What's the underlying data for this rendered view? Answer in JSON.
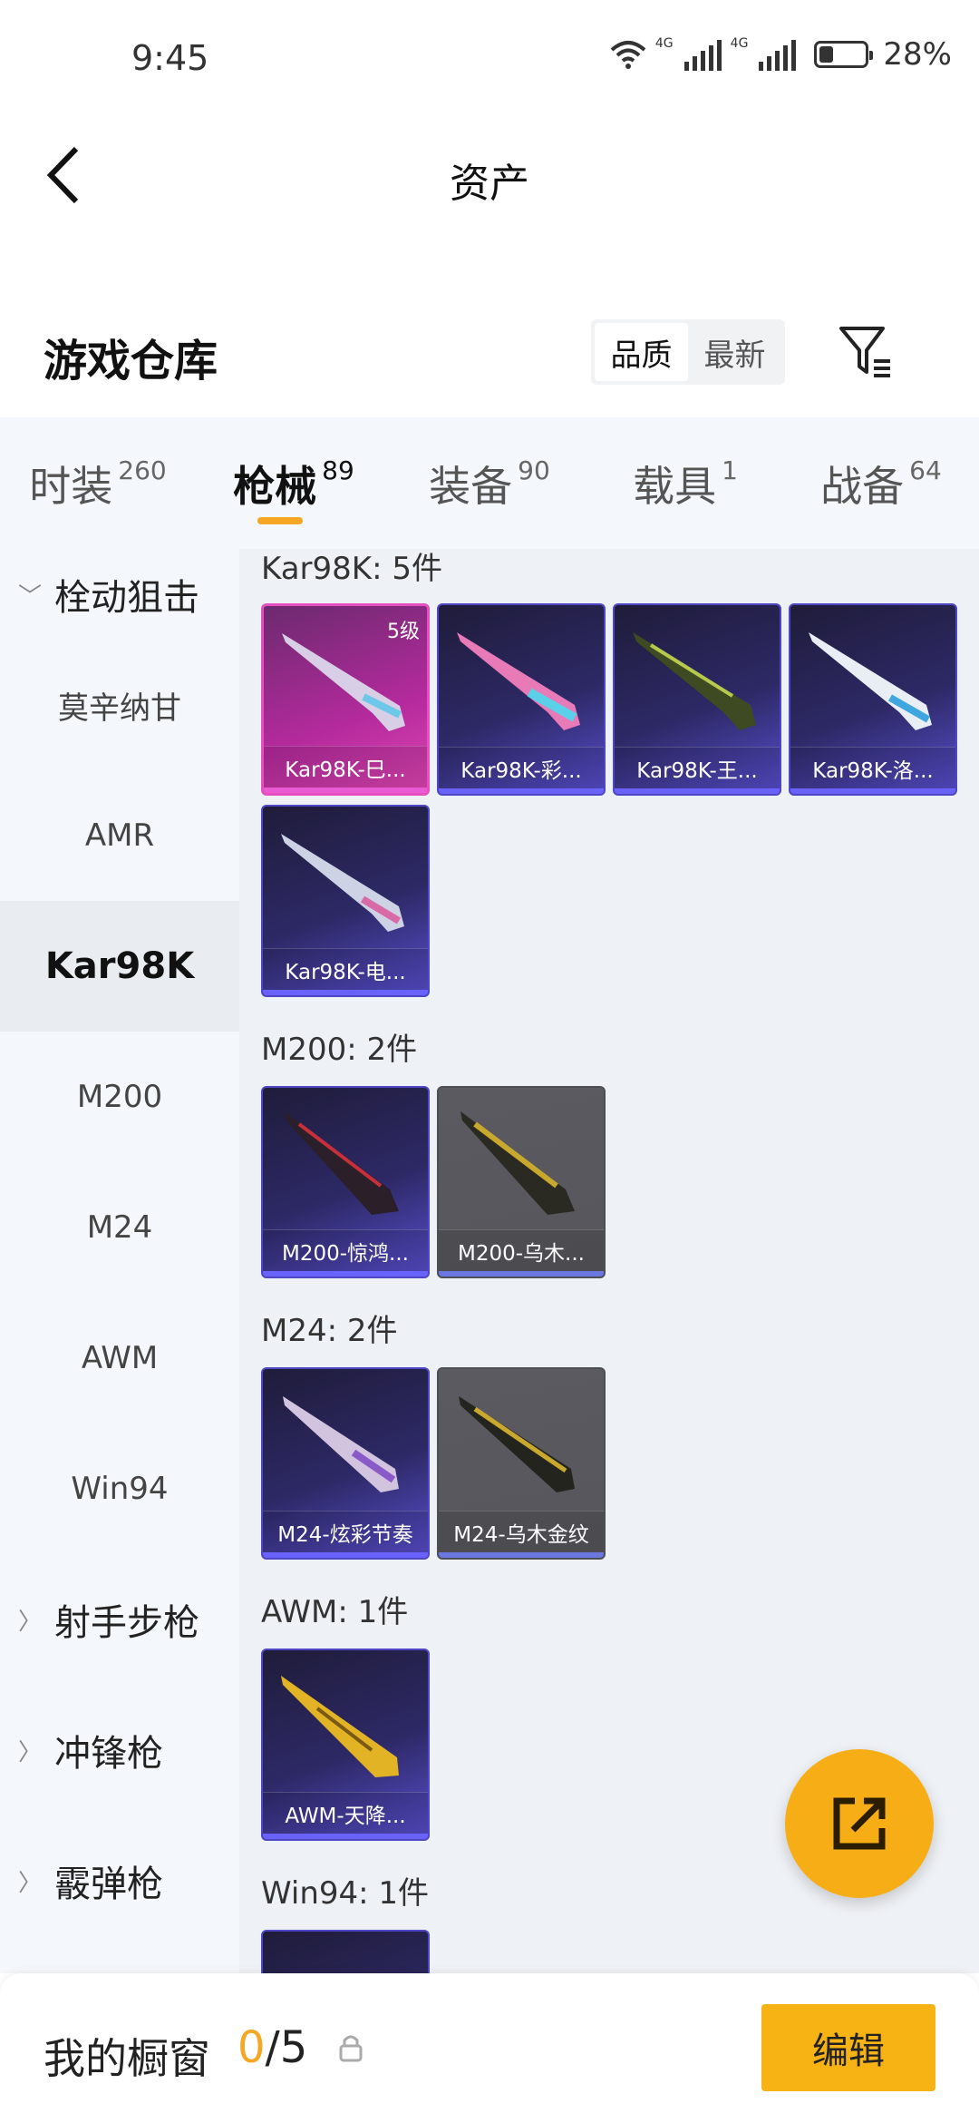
{
  "status": {
    "time": "9:45",
    "net1": "4G",
    "net2": "4G",
    "battery_pct": "28%",
    "battery_level": 0.28
  },
  "nav": {
    "title": "资产"
  },
  "warehouse": {
    "title": "游戏仓库",
    "sort_quality": "品质",
    "sort_newest": "最新"
  },
  "tabs": [
    {
      "label": "时装",
      "count": "260"
    },
    {
      "label": "枪械",
      "count": "89"
    },
    {
      "label": "装备",
      "count": "90"
    },
    {
      "label": "载具",
      "count": "1"
    },
    {
      "label": "战备",
      "count": "64"
    }
  ],
  "side_menu": {
    "group1": "栓动狙击",
    "items": [
      "莫辛纳甘",
      "AMR",
      "Kar98K",
      "M200",
      "M24",
      "AWM",
      "Win94"
    ],
    "group2": "射手步枪",
    "group3": "冲锋枪",
    "group4": "霰弹枪"
  },
  "sections": [
    {
      "title": "Kar98K: 5件",
      "cards": [
        "Kar98K-巳...",
        "Kar98K-彩...",
        "Kar98K-王...",
        "Kar98K-洛...",
        "Kar98K-电..."
      ],
      "level_badge": "5级"
    },
    {
      "title": "M200: 2件",
      "cards": [
        "M200-惊鸿...",
        "M200-乌木..."
      ]
    },
    {
      "title": "M24: 2件",
      "cards": [
        "M24-炫彩节奏",
        "M24-乌木金纹"
      ]
    },
    {
      "title": "AWM: 1件",
      "cards": [
        "AWM-天降..."
      ]
    },
    {
      "title": "Win94: 1件"
    }
  ],
  "bottom": {
    "showcase_label": "我的橱窗",
    "showcase_current": "0",
    "showcase_total": "/5",
    "edit_label": "编辑"
  },
  "colors": {
    "accent": "#f5a623",
    "edit_button": "#f7b214",
    "card_purple": "#4e46c4",
    "card_pink": "#e64fc0"
  },
  "icons": [
    "back-arrow-icon",
    "filter-icon",
    "wifi-icon",
    "signal-icon",
    "battery-icon",
    "share-icon",
    "lock-icon",
    "chevron-down-icon",
    "chevron-right-icon"
  ]
}
